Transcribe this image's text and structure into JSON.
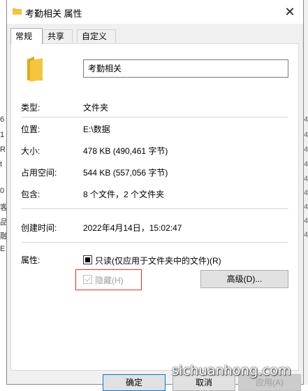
{
  "window": {
    "title": "考勤相关 属性",
    "close_glyph": "✕"
  },
  "tabs": [
    "常规",
    "共享",
    "自定义"
  ],
  "general": {
    "name_value": "考勤相关",
    "type_label": "类型:",
    "type_value": "文件夹",
    "location_label": "位置:",
    "location_value": "E:\\数据",
    "size_label": "大小:",
    "size_value": "478 KB (490,461 字节)",
    "size_on_disk_label": "占用空间:",
    "size_on_disk_value": "544 KB (557,056 字节)",
    "contains_label": "包含:",
    "contains_value": "8 个文件，2 个文件夹",
    "created_label": "创建时间:",
    "created_value": "2022年4月14日，15:02:47",
    "attributes_label": "属性:",
    "readonly_label": "只读(仅应用于文件夹中的文件)(R)",
    "readonly_state": "indeterminate",
    "hidden_label": "隐藏(H)",
    "hidden_state": "checked-disabled",
    "advanced_button": "高级(D)..."
  },
  "buttons": {
    "ok": "确定",
    "cancel": "取消",
    "apply": "应用(A)"
  },
  "watermark": "sichuanhong.com",
  "background_fragments": {
    "left": [
      "6",
      "1",
      "R",
      "t",
      "0",
      "客",
      "品",
      "融",
      "E"
    ],
    "right": [
      "4",
      "4",
      "4",
      "4",
      "4",
      "4",
      "4",
      "4",
      "4"
    ]
  },
  "colors": {
    "highlight_border": "#e0352b",
    "primary_button_border": "#0078d7",
    "folder_yellow": "#f5c53b"
  }
}
